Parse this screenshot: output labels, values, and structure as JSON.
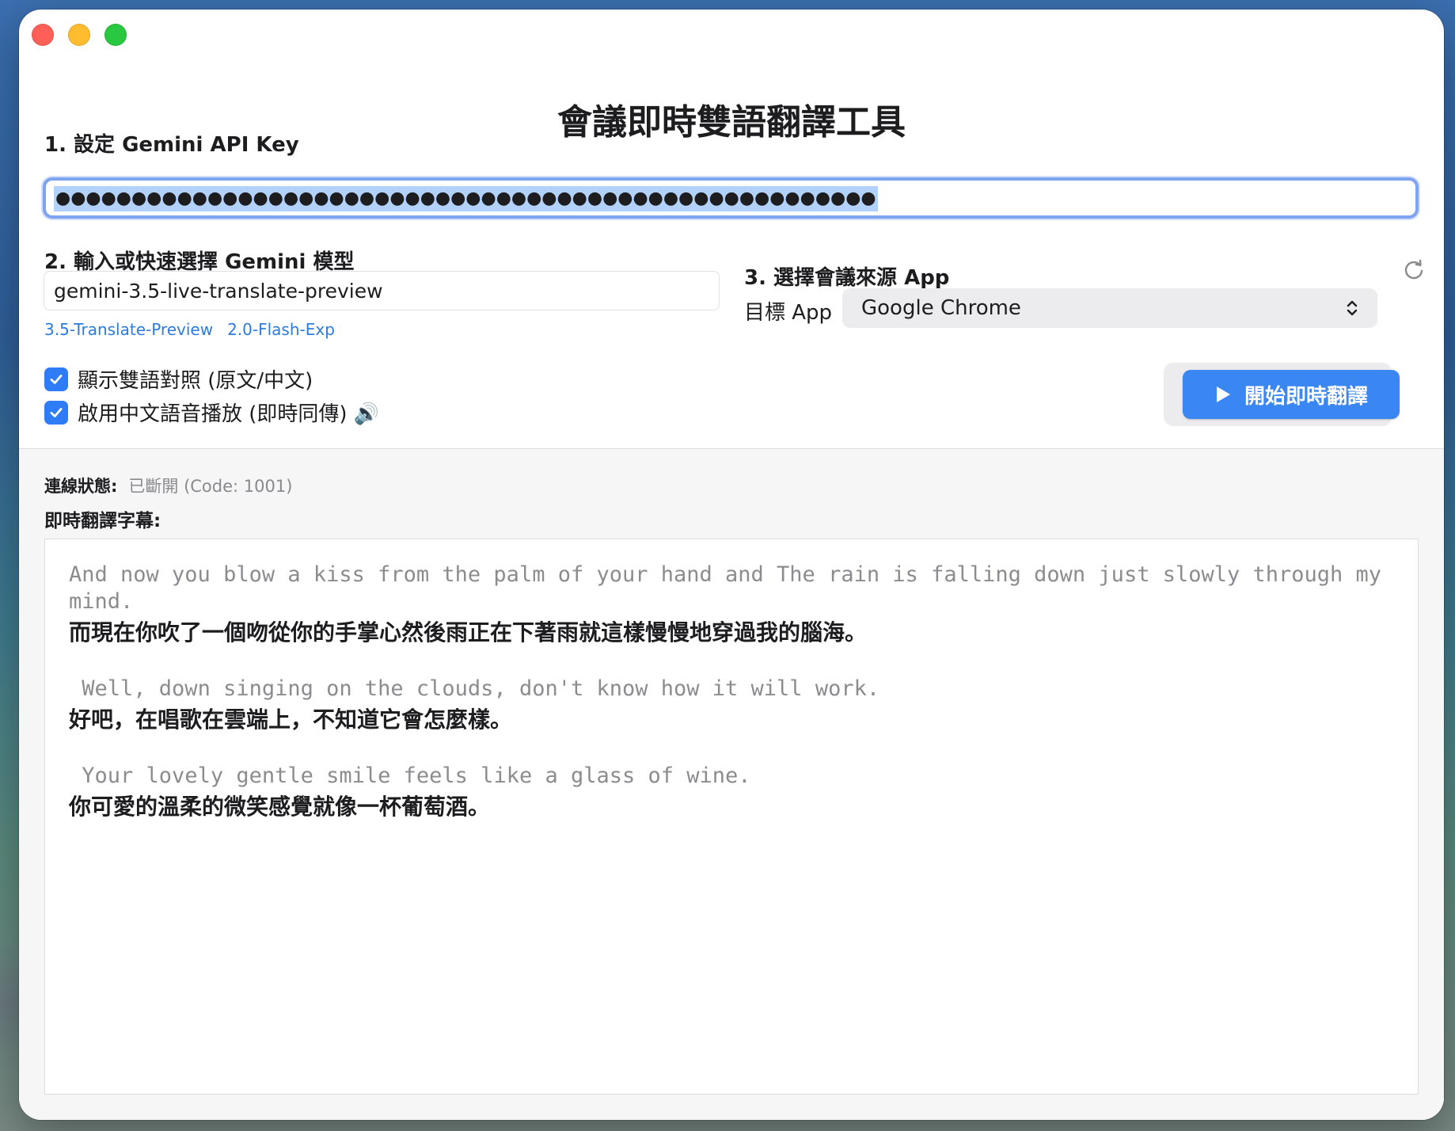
{
  "app": {
    "title": "會議即時雙語翻譯工具"
  },
  "api_key": {
    "label": "1. 設定 Gemini API Key",
    "masked_value": "●●●●●●●●●●●●●●●●●●●●●●●●●●●●●●●●●●●●●●●●●●●●●●●●●●●●●●"
  },
  "model": {
    "label": "2. 輸入或快速選擇 Gemini 模型",
    "value": "gemini-3.5-live-translate-preview",
    "quick_options": [
      "3.5-Translate-Preview",
      "2.0-Flash-Exp"
    ]
  },
  "source_app": {
    "label": "3. 選擇會議來源 App",
    "target_label": "目標 App",
    "selected": "Google Chrome"
  },
  "options": {
    "bilingual_label": "顯示雙語對照 (原文/中文)",
    "voice_label": "啟用中文語音播放 (即時同傳) 🔊"
  },
  "start_button": {
    "label": "開始即時翻譯"
  },
  "status": {
    "key": "連線狀態:",
    "value": "已斷開 (Code: 1001)"
  },
  "subtitles": {
    "label": "即時翻譯字幕:",
    "segments": [
      {
        "source": "And now you blow a kiss from the palm of your hand and The rain is falling down just slowly through my mind.",
        "translation": "而現在你吹了一個吻從你的手掌心然後雨正在下著雨就這樣慢慢地穿過我的腦海。"
      },
      {
        "source": " Well, down singing on the clouds, don't know how it will work.",
        "translation": "好吧，在唱歌在雲端上，不知道它會怎麼樣。"
      },
      {
        "source": " Your lovely gentle smile feels like a glass of wine.",
        "translation": "你可愛的溫柔的微笑感覺就像一杯葡萄酒。"
      }
    ]
  },
  "colors": {
    "accent": "#3a86f2",
    "link": "#2b7be0",
    "focus_ring": "#7ea3f1"
  }
}
